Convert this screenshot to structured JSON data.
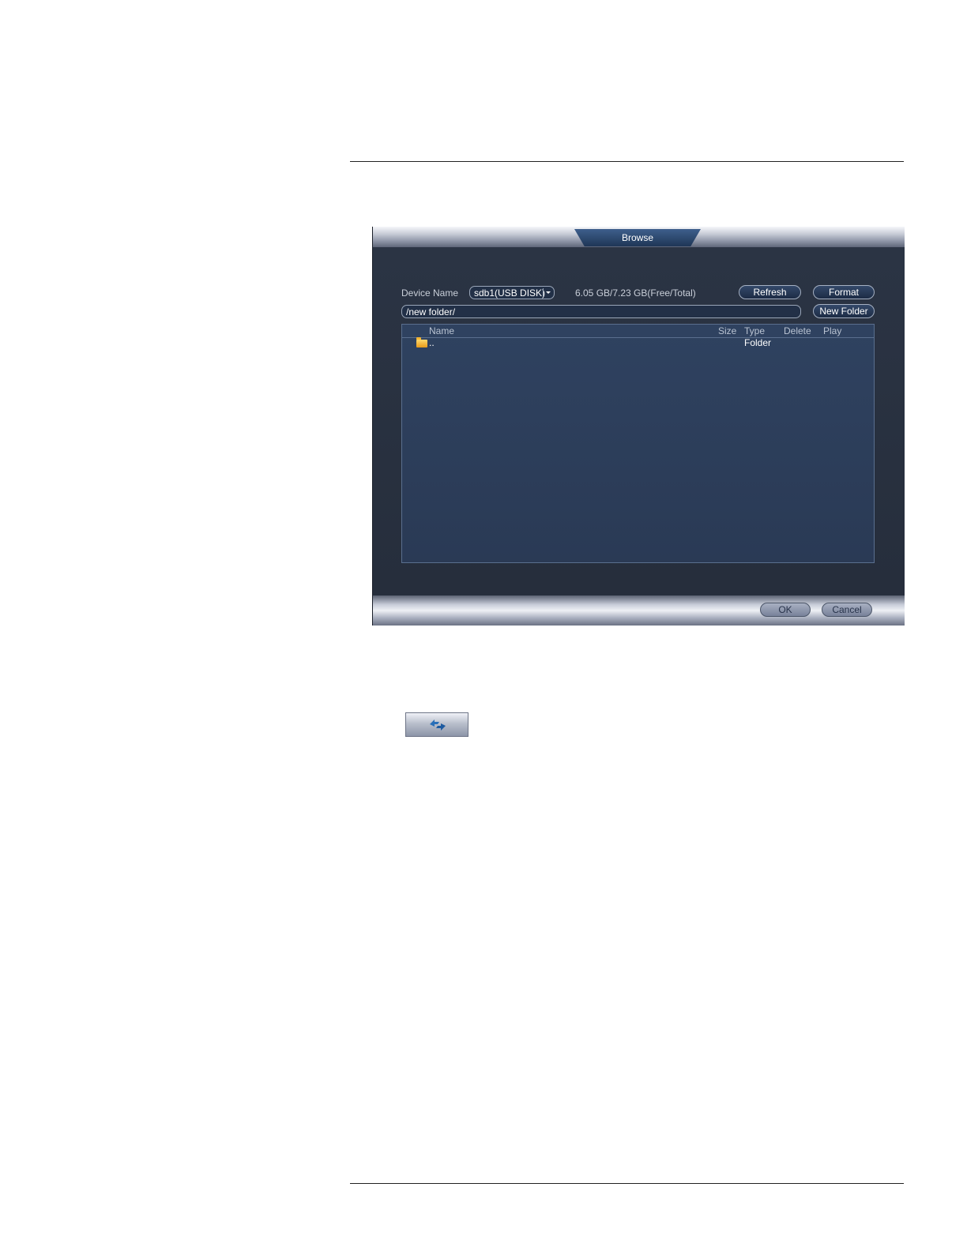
{
  "dialog": {
    "title": "Browse",
    "device_label": "Device Name",
    "device_value": "sdb1(USB DISK)",
    "storage": "6.05 GB/7.23 GB(Free/Total)",
    "path": "/new folder/",
    "buttons": {
      "refresh": "Refresh",
      "format": "Format",
      "new_folder": "New Folder",
      "ok": "OK",
      "cancel": "Cancel"
    },
    "columns": {
      "name": "Name",
      "size": "Size",
      "type": "Type",
      "delete": "Delete",
      "play": "Play"
    },
    "rows": [
      {
        "name": "..",
        "type": "Folder",
        "icon": "folder-icon"
      }
    ]
  },
  "toolbar_icon": {
    "icon": "refresh-arrows-icon"
  },
  "colors": {
    "dialog_bg": "#283141",
    "list_bg": "#2f4260",
    "title_tab": "#2c4a73",
    "folder": "#f3b534",
    "arrow_icon": "#2a6fb8"
  }
}
